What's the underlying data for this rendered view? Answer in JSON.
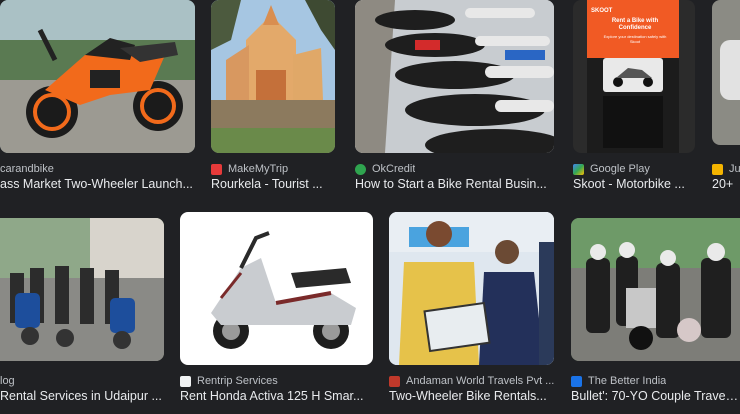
{
  "row1": [
    {
      "source": "carandbike",
      "title": "ass Market Two-Wheeler Launch..."
    },
    {
      "source": "MakeMyTrip",
      "title": "Rourkela - Tourist ..."
    },
    {
      "source": "OkCredit",
      "title": "How to Start a Bike Rental Busin..."
    },
    {
      "source": "Google Play",
      "title": "Skoot - Motorbike ..."
    },
    {
      "source": "Ju",
      "title": "20+"
    }
  ],
  "row2": [
    {
      "source": "log",
      "title": "Rental Services in Udaipur ..."
    },
    {
      "source": "Rentrip Services",
      "title": "Rent Honda Activa 125 H Smar..."
    },
    {
      "source": "Andaman World Travels Pvt ...",
      "title": "Two-Wheeler Bike Rentals..."
    },
    {
      "source": "The Better India",
      "title": "Bullet': 70-YO Couple Travel ..."
    }
  ],
  "skoot_ad": {
    "brand": "SKOOT",
    "headline": "Rent a Bike with Confidence",
    "sub": "Explore your destination safely with Skoot"
  },
  "colors": {
    "background": "#202124",
    "caption": "#e8eaed",
    "source": "#bdc1c6",
    "makemytrip_icon": "#e63a3a",
    "okcredit_icon": "#2fa44f",
    "googleplay_icon": "#4285f4",
    "ju_icon": "#f4b400",
    "rentrip_icon": "#f1f3f4",
    "andaman_icon": "#c0392b",
    "betterindia_icon": "#1a73e8",
    "skoot_orange": "#f15a24"
  }
}
